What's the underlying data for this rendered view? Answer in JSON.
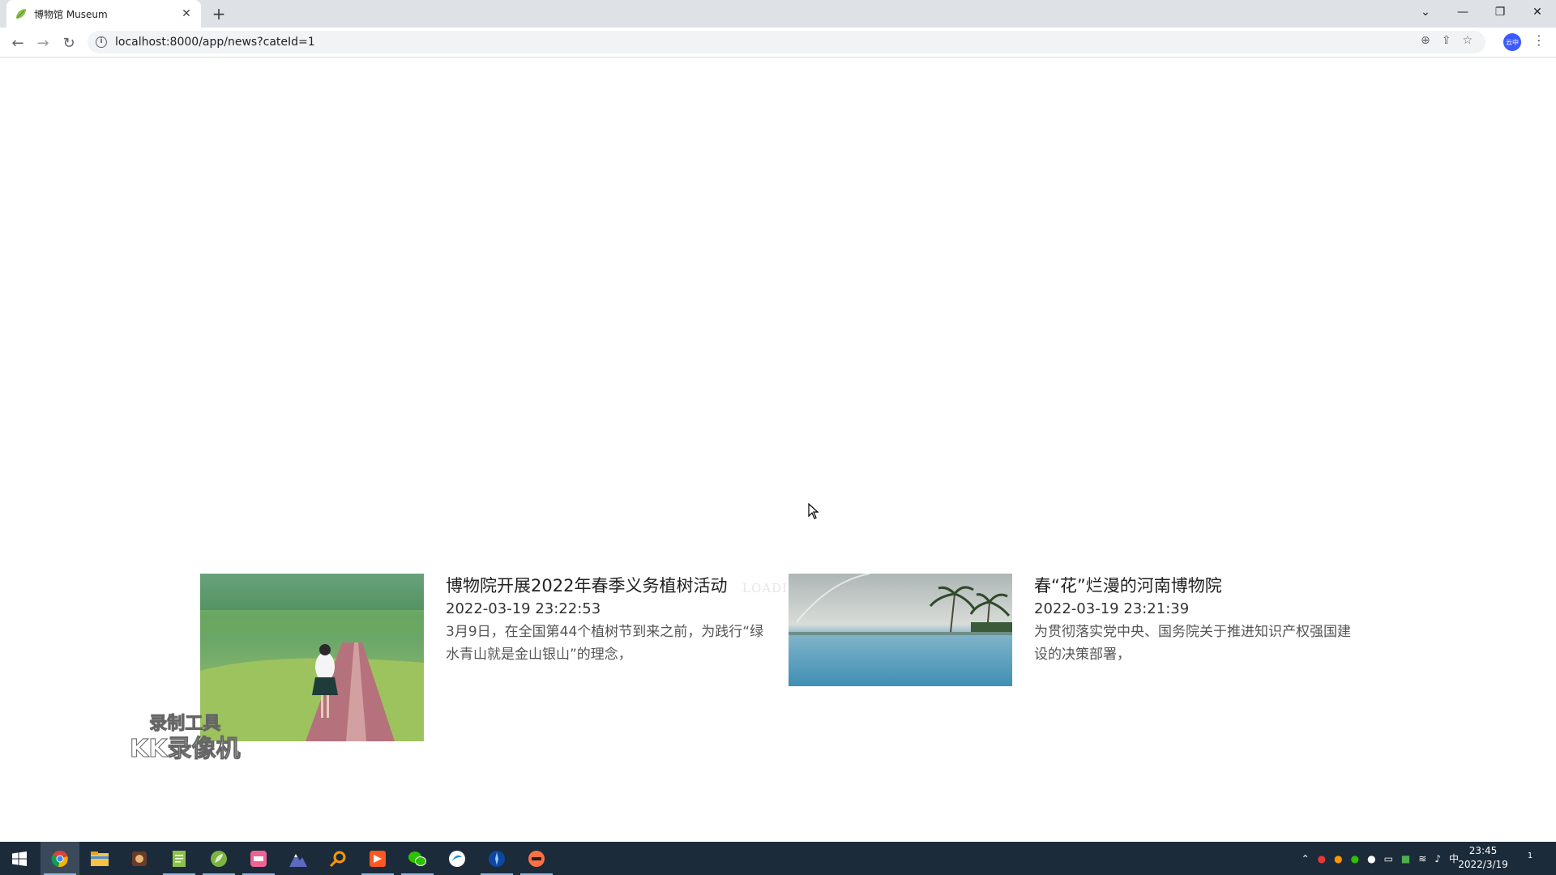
{
  "browser": {
    "tab_title": "博物馆 Museum",
    "url": "localhost:8000/app/news?cateId=1",
    "profile_label": "云中"
  },
  "page": {
    "loading_text": "LOADING",
    "news": [
      {
        "title": "博物院开展2022年春季义务植树活动",
        "date": "2022-03-19 23:22:53",
        "desc": "3月9日，在全国第44个植树节到来之前，为践行“绿水青山就是金山银山”的理念，"
      },
      {
        "title": "春“花”烂漫的河南博物院",
        "date": "2022-03-19 23:21:39",
        "desc": "为贯彻落实党中央、国务院关于推进知识产权强国建设的决策部署，"
      }
    ],
    "watermark": {
      "line1": "录制工具",
      "line2": "KK录像机"
    }
  },
  "taskbar": {
    "apps": [
      "chrome-icon",
      "file-explorer-icon",
      "game-icon",
      "notepad-icon",
      "leaf-app-icon",
      "pink-app-icon",
      "mountain-app-icon",
      "search-app-icon",
      "media-app-icon",
      "wechat-icon",
      "blue-circle-app-icon",
      "compass-app-icon",
      "orange-app-icon"
    ],
    "ime": "中",
    "time": "23:45",
    "date": "2022/3/19",
    "notification_count": "1"
  }
}
